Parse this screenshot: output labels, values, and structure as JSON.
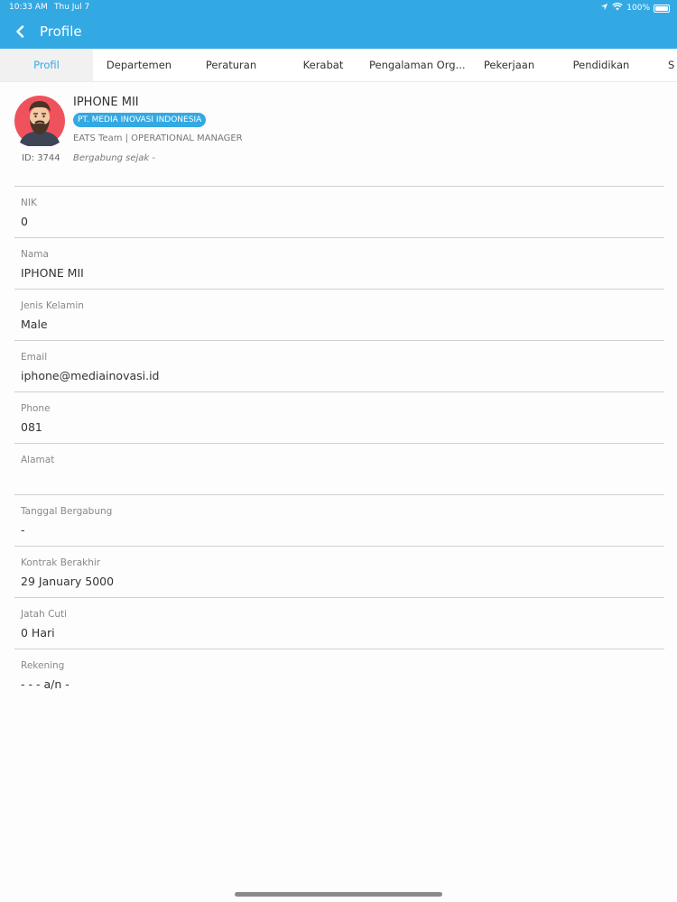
{
  "status_bar": {
    "time": "10:33 AM",
    "date": "Thu Jul 7",
    "battery": "100%"
  },
  "app_bar": {
    "title": "Profile"
  },
  "tabs": [
    {
      "label": "Profil"
    },
    {
      "label": "Departemen"
    },
    {
      "label": "Peraturan"
    },
    {
      "label": "Kerabat"
    },
    {
      "label": "Pengalaman Org..."
    },
    {
      "label": "Pekerjaan"
    },
    {
      "label": "Pendidikan"
    },
    {
      "label": "S"
    }
  ],
  "profile": {
    "name": "IPHONE MII",
    "company": "PT. MEDIA INOVASI INDONESIA",
    "team_role": "EATS Team | OPERATIONAL MANAGER",
    "id_text": "ID: 3744",
    "joined_text": "Bergabung sejak -"
  },
  "fields": [
    {
      "label": "NIK",
      "value": "0"
    },
    {
      "label": "Nama",
      "value": "IPHONE MII"
    },
    {
      "label": "Jenis Kelamin",
      "value": "Male"
    },
    {
      "label": "Email",
      "value": "iphone@mediainovasi.id"
    },
    {
      "label": "Phone",
      "value": "081"
    },
    {
      "label": "Alamat",
      "value": ""
    },
    {
      "label": "Tanggal Bergabung",
      "value": "-"
    },
    {
      "label": "Kontrak Berakhir",
      "value": "29 January 5000"
    },
    {
      "label": "Jatah Cuti",
      "value": "0  Hari"
    },
    {
      "label": "Rekening",
      "value": "- - - a/n -"
    }
  ],
  "colors": {
    "primary": "#33a9e3",
    "avatar_bg": "#f0525d"
  },
  "icons": {
    "back": "chevron-left-icon",
    "location": "location-arrow-icon",
    "wifi": "wifi-icon",
    "battery": "battery-icon"
  }
}
